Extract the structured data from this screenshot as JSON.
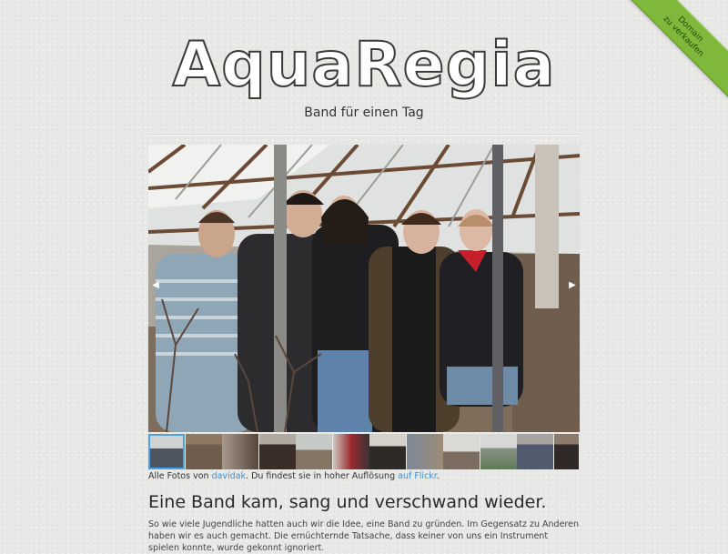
{
  "ribbon": {
    "line1": "Domain",
    "line2": "zu verkaufen",
    "color": "#7fb83a"
  },
  "header": {
    "logo": "AquaRegia",
    "tagline": "Band für einen Tag"
  },
  "slider": {
    "prev_icon": "chevron-left-icon",
    "next_icon": "chevron-right-icon",
    "active_thumb": 0,
    "thumb_count": 12
  },
  "caption": {
    "prefix": "Alle Fotos von ",
    "author_link": "davidak",
    "middle": ". Du findest sie in hoher Auflösung ",
    "flickr_link": "auf Flickr",
    "suffix": "."
  },
  "article": {
    "headline": "Eine Band kam, sang und verschwand wieder.",
    "paragraph": "So wie viele Jugendliche hatten auch wir die Idee, eine Band zu gründen. Im Gegensatz zu Anderen haben wir es auch gemacht. Die ernüchternde Tatsache, dass keiner von uns ein Instrument spielen konnte, wurde gekonnt ignoriert."
  },
  "colors": {
    "link": "#3a8fd1",
    "active_thumb_border": "#4aa3df",
    "background": "#e8e8e6"
  }
}
